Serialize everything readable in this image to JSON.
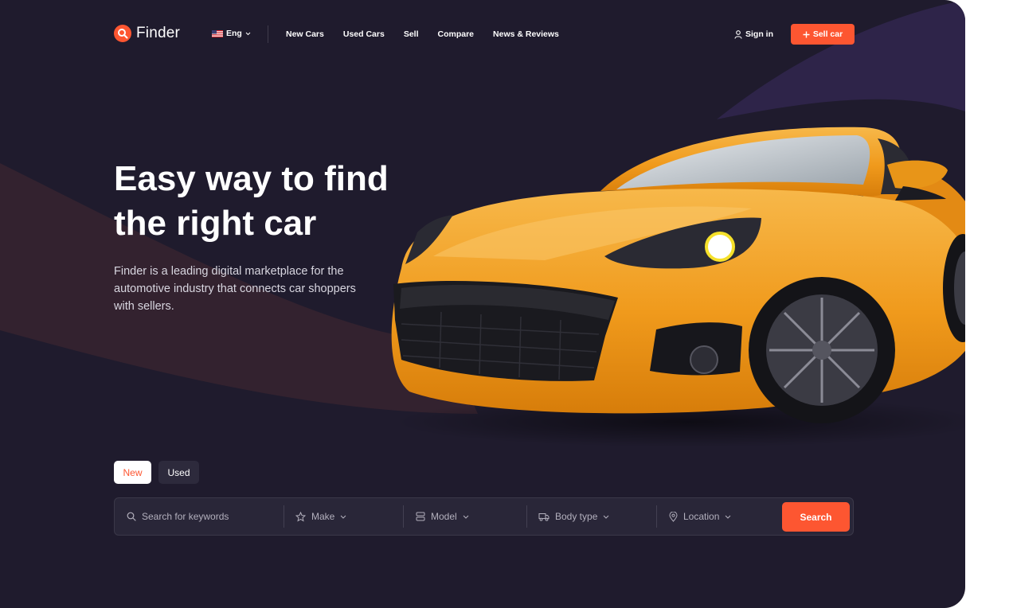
{
  "brand": {
    "name": "Finder"
  },
  "header": {
    "language": "Eng",
    "nav": [
      "New Cars",
      "Used Cars",
      "Sell",
      "Compare",
      "News & Reviews"
    ],
    "signin_label": "Sign in",
    "sell_label": "Sell car"
  },
  "hero": {
    "title_line1": "Easy way to find",
    "title_line2": "the right car",
    "description": "Finder is a leading digital marketplace for the automotive industry that connects car shoppers with sellers."
  },
  "tabs": {
    "new_label": "New",
    "used_label": "Used",
    "active": "New"
  },
  "search": {
    "keywords_placeholder": "Search for keywords",
    "make_label": "Make",
    "model_label": "Model",
    "body_type_label": "Body type",
    "location_label": "Location",
    "button_label": "Search"
  },
  "colors": {
    "accent": "#fd5631",
    "background": "#1f1b2d",
    "car": "#f39a1d"
  },
  "icons": [
    "search-icon",
    "flag-us-icon",
    "chevron-down-icon",
    "user-icon",
    "plus-icon",
    "star-icon",
    "model-icon",
    "truck-icon",
    "map-pin-icon"
  ]
}
